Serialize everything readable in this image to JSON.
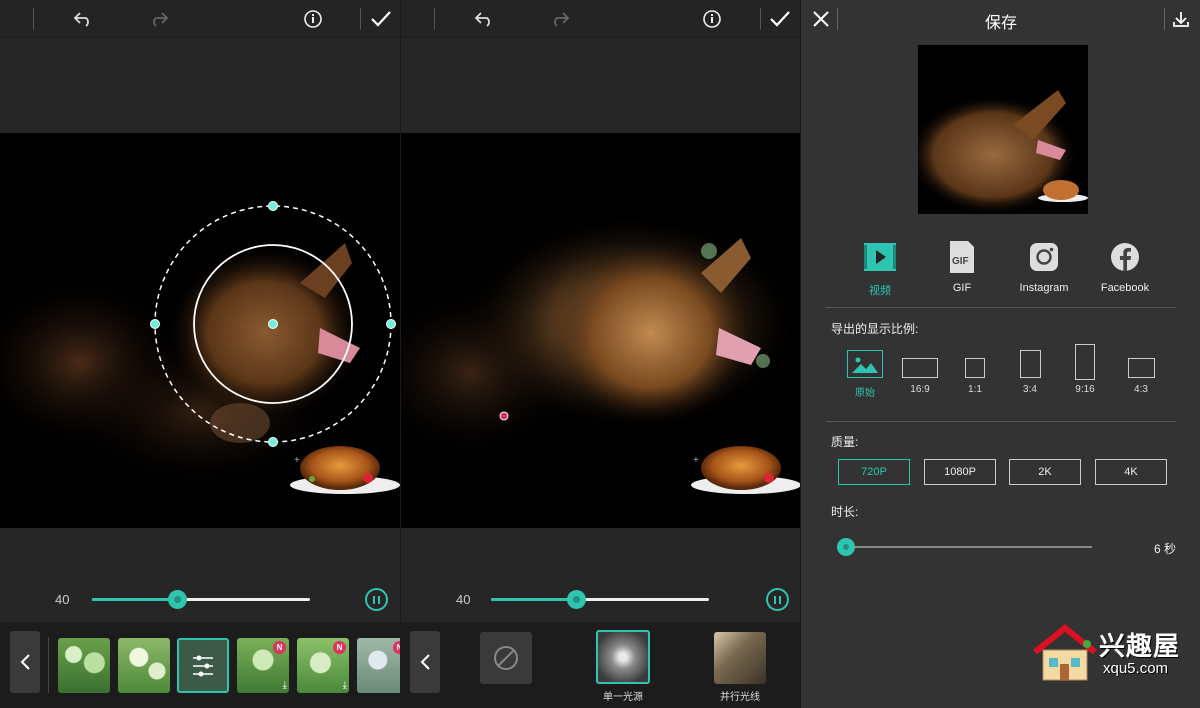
{
  "panel_left": {
    "slider_value": "40",
    "slider_fraction": 0.39,
    "filters": [
      {
        "name": "bokeh-green",
        "badge": "",
        "download": false,
        "selected": false
      },
      {
        "name": "bokeh-light",
        "badge": "",
        "download": false,
        "selected": false
      },
      {
        "name": "adjust-settings",
        "badge": "",
        "download": false,
        "selected": true
      },
      {
        "name": "bunny-bokeh",
        "badge": "N",
        "download": true,
        "selected": false
      },
      {
        "name": "bunny-bokeh-2",
        "badge": "N",
        "download": true,
        "selected": false
      },
      {
        "name": "flower-bokeh",
        "badge": "N",
        "download": false,
        "selected": false
      }
    ]
  },
  "panel_middle": {
    "slider_value": "40",
    "slider_fraction": 0.39,
    "effects": [
      {
        "label": "",
        "kind": "none"
      },
      {
        "label": "单一光源",
        "kind": "single-light"
      },
      {
        "label": "并行光线",
        "kind": "parallel-light"
      }
    ]
  },
  "panel_save": {
    "title": "保存",
    "share": [
      {
        "label": "视频",
        "icon": "video-icon",
        "active": true
      },
      {
        "label": "GIF",
        "icon": "gif-icon",
        "active": false
      },
      {
        "label": "Instagram",
        "icon": "instagram-icon",
        "active": false
      },
      {
        "label": "Facebook",
        "icon": "facebook-icon",
        "active": false
      }
    ],
    "ratio_title": "导出的显示比例:",
    "ratios": [
      {
        "label": "原始",
        "active": true
      },
      {
        "label": "16:9",
        "active": false
      },
      {
        "label": "1:1",
        "active": false
      },
      {
        "label": "3:4",
        "active": false
      },
      {
        "label": "9:16",
        "active": false
      },
      {
        "label": "4:3",
        "active": false
      }
    ],
    "quality_title": "质量:",
    "qualities": [
      {
        "label": "720P",
        "active": true
      },
      {
        "label": "1080P",
        "active": false
      },
      {
        "label": "2K",
        "active": false
      },
      {
        "label": "4K",
        "active": false
      }
    ],
    "duration_title": "时长:",
    "duration_value": "6 秒",
    "duration_fraction": 0.0
  },
  "watermark": {
    "brand": "兴趣屋",
    "url": "xqu5.com"
  },
  "colors": {
    "accent": "#2ec4b0",
    "badge": "#e0315f"
  }
}
